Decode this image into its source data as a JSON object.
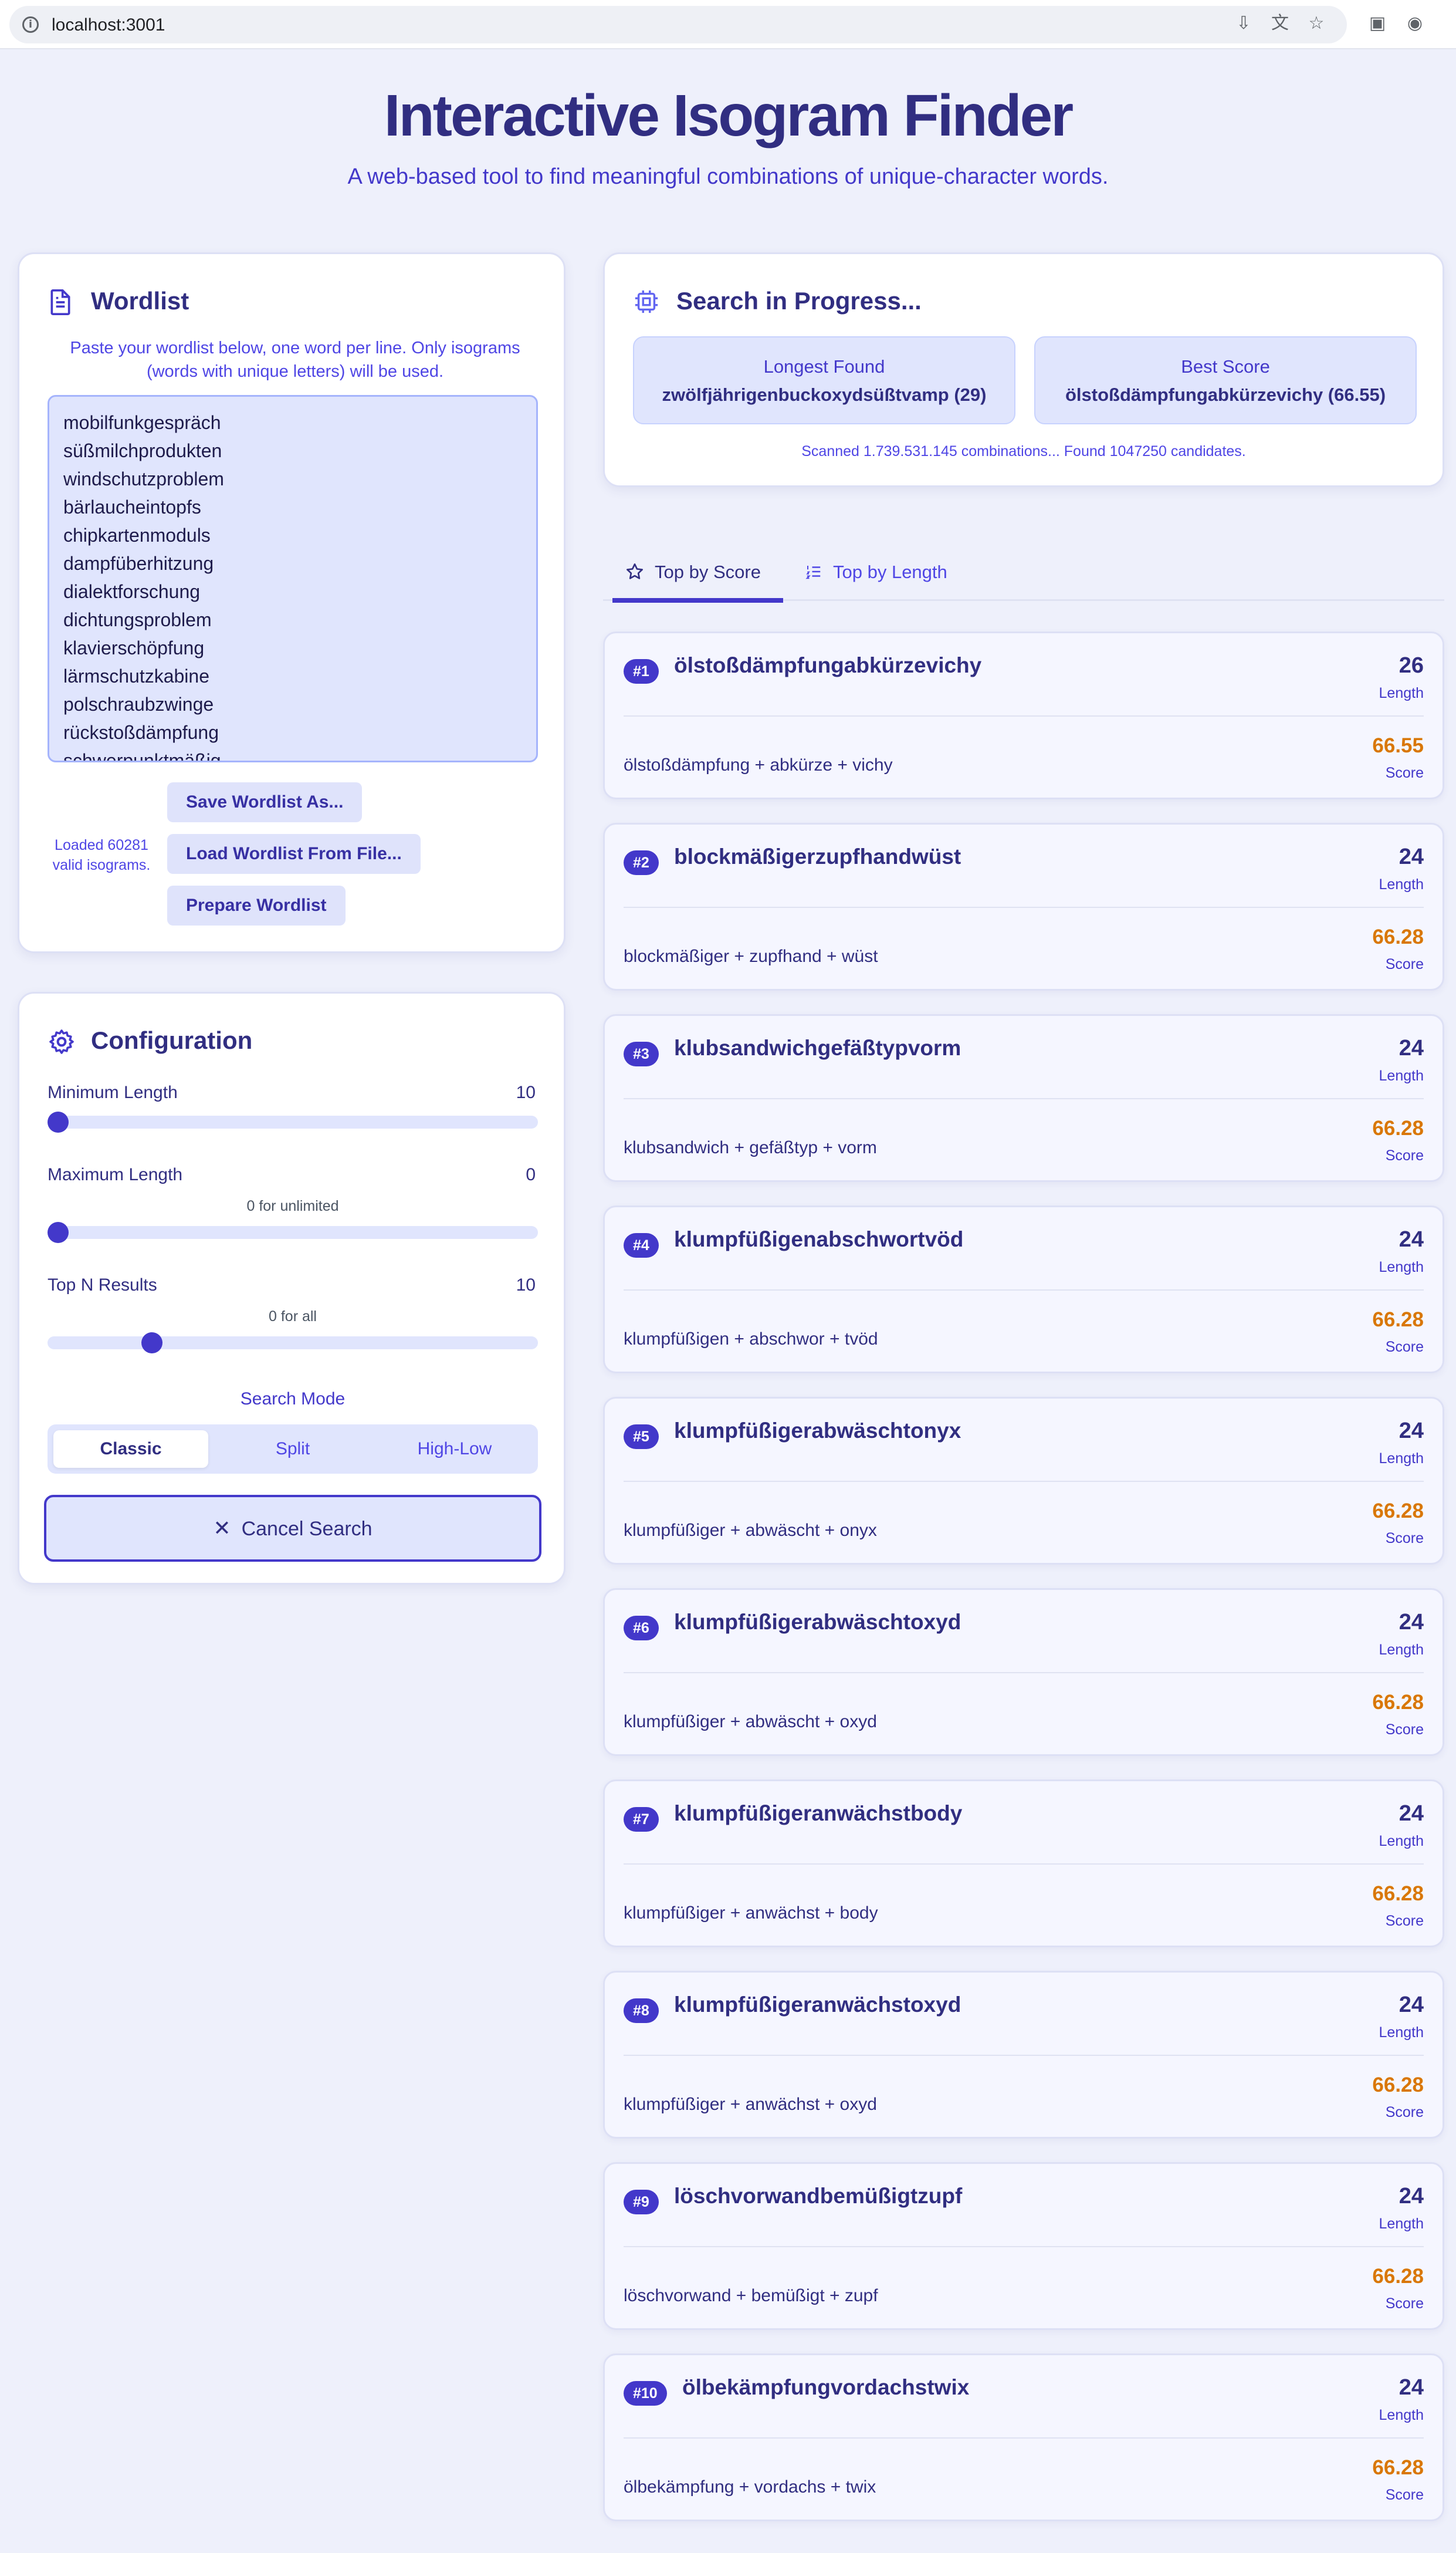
{
  "browser": {
    "url": "localhost:3001",
    "icons": [
      "install-app-icon",
      "translate-icon",
      "bookmark-star-icon",
      "extension-icon",
      "profile-icon"
    ]
  },
  "header": {
    "title": "Interactive Isogram Finder",
    "subtitle": "A web-based tool to find meaningful combinations of unique-character words."
  },
  "wordlist": {
    "title": "Wordlist",
    "hint": "Paste your wordlist below, one word per line. Only isograms (words with unique letters) will be used.",
    "lines": [
      "mobilfunkgespräch",
      "süßmilchprodukten",
      "windschutzproblem",
      "bärlaucheintopfs",
      "chipkartenmoduls",
      "dampfüberhitzung",
      "dialektforschung",
      "dichtungsproblem",
      "klavierschöpfung",
      "lärmschutzkabine",
      "polschraubzwinge",
      "rückstoßdämpfung",
      "schwerpunktmäßig"
    ],
    "status": "Loaded 60281 valid isograms.",
    "buttons": {
      "save": "Save Wordlist As...",
      "load": "Load Wordlist From File...",
      "prepare": "Prepare Wordlist"
    }
  },
  "config": {
    "title": "Configuration",
    "min_length": {
      "label": "Minimum Length",
      "value": "10",
      "fraction": 0.0
    },
    "max_length": {
      "label": "Maximum Length",
      "value": "0",
      "note": "0 for unlimited",
      "fraction": 0.0
    },
    "top_n": {
      "label": "Top N Results",
      "value": "10",
      "note": "0 for all",
      "fraction": 0.2
    },
    "search_mode": {
      "label": "Search Mode",
      "options": [
        "Classic",
        "Split",
        "High-Low"
      ],
      "selected": "Classic"
    },
    "cancel_label": "Cancel Search"
  },
  "progress": {
    "title": "Search in Progress...",
    "longest": {
      "label": "Longest Found",
      "value": "zwölfjährigenbuckoxydsüßtvamp (29)"
    },
    "best": {
      "label": "Best Score",
      "value": "ölstoßdämpfungabkürzevichy (66.55)"
    },
    "status": "Scanned 1.739.531.145 combinations... Found 1047250 candidates."
  },
  "tabs": [
    {
      "label": "Top by Score",
      "active": true
    },
    {
      "label": "Top by Length",
      "active": false
    }
  ],
  "results": {
    "length_label": "Length",
    "score_label": "Score",
    "items": [
      {
        "rank": "#1",
        "word": "ölstoßdämpfungabkürzevichy",
        "length": "26",
        "parts": "ölstoßdämpfung + abkürze + vichy",
        "score": "66.55"
      },
      {
        "rank": "#2",
        "word": "blockmäßigerzupfhandwüst",
        "length": "24",
        "parts": "blockmäßiger + zupfhand + wüst",
        "score": "66.28"
      },
      {
        "rank": "#3",
        "word": "klubsandwichgefäßtypvorm",
        "length": "24",
        "parts": "klubsandwich + gefäßtyp + vorm",
        "score": "66.28"
      },
      {
        "rank": "#4",
        "word": "klumpfüßigenabschwortvöd",
        "length": "24",
        "parts": "klumpfüßigen + abschwor + tvöd",
        "score": "66.28"
      },
      {
        "rank": "#5",
        "word": "klumpfüßigerabwäschtonyx",
        "length": "24",
        "parts": "klumpfüßiger + abwäscht + onyx",
        "score": "66.28"
      },
      {
        "rank": "#6",
        "word": "klumpfüßigerabwäschtoxyd",
        "length": "24",
        "parts": "klumpfüßiger + abwäscht + oxyd",
        "score": "66.28"
      },
      {
        "rank": "#7",
        "word": "klumpfüßigeranwächstbody",
        "length": "24",
        "parts": "klumpfüßiger + anwächst + body",
        "score": "66.28"
      },
      {
        "rank": "#8",
        "word": "klumpfüßigeranwächstoxyd",
        "length": "24",
        "parts": "klumpfüßiger + anwächst + oxyd",
        "score": "66.28"
      },
      {
        "rank": "#9",
        "word": "löschvorwandbemüßigtzupf",
        "length": "24",
        "parts": "löschvorwand + bemüßigt + zupf",
        "score": "66.28"
      },
      {
        "rank": "#10",
        "word": "ölbekämpfungvordachstwix",
        "length": "24",
        "parts": "ölbekämpfung + vordachs + twix",
        "score": "66.28"
      }
    ]
  }
}
